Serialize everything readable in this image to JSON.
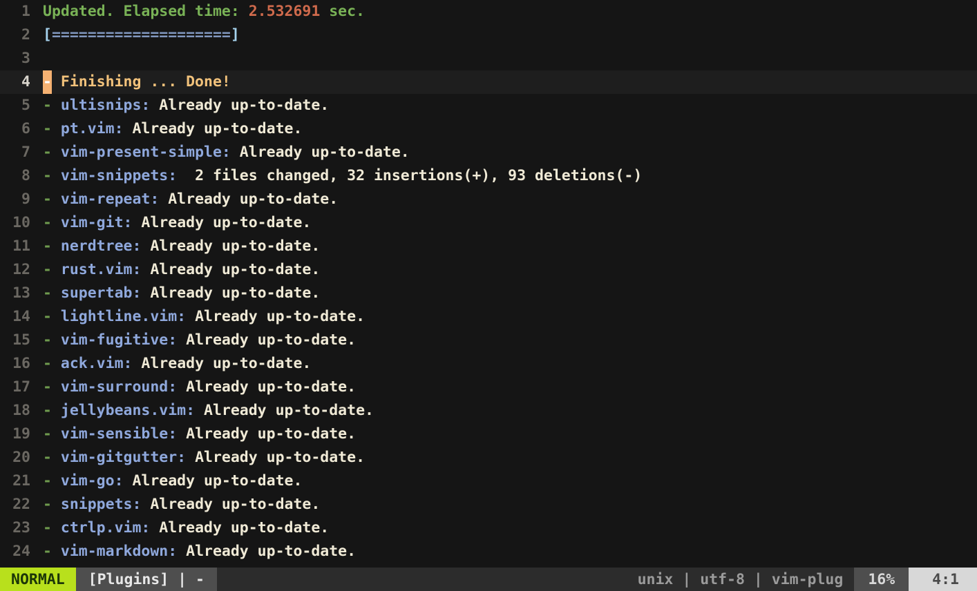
{
  "app": {
    "type": "terminal-vim",
    "buffer_name": "[Plugins]",
    "colors": {
      "background": "#151515",
      "cursorline_bg": "#1e1e1e",
      "linenumber": "#6b6862",
      "linenumber_active": "#d8d4cc",
      "green": "#79b256",
      "red": "#cf6a4c",
      "bracket_blue": "#a6d3ee",
      "equals_blue": "#8197bf",
      "dash_green": "#6f9b4e",
      "plugin_blue": "#8fa8dc",
      "message_cream": "#f0ead6",
      "done_yellow": "#f2c27b",
      "cursor_orange": "#f5b172",
      "status_mode_bg": "#b8e01c",
      "status_mode_fg": "#1c3608",
      "status_file_bg": "#4e4e4e",
      "status_mid_bg": "#2c2c2c",
      "status_pos_bg": "#d8d8d8"
    }
  },
  "buffer": {
    "lines": [
      {
        "number": "1",
        "cursorline": false,
        "segments": [
          {
            "text": "Updated. Elapsed time: ",
            "cls": "c-green"
          },
          {
            "text": "2.532691",
            "cls": "c-red"
          },
          {
            "text": " sec.",
            "cls": "c-green"
          }
        ]
      },
      {
        "number": "2",
        "cursorline": false,
        "segments": [
          {
            "text": "[",
            "cls": "c-bracket"
          },
          {
            "text": "====================",
            "cls": "c-eq"
          },
          {
            "text": "]",
            "cls": "c-bracket"
          }
        ]
      },
      {
        "number": "3",
        "cursorline": false,
        "segments": []
      },
      {
        "number": "4",
        "cursorline": true,
        "segments": [
          {
            "text": "-",
            "cls": "cursor"
          },
          {
            "text": " Finishing ... Done!",
            "cls": "c-done"
          }
        ]
      },
      {
        "number": "5",
        "cursorline": false,
        "segments": [
          {
            "text": "-",
            "cls": "c-dash"
          },
          {
            "text": " ",
            "cls": "c-msg"
          },
          {
            "text": "ultisnips:",
            "cls": "c-plugin"
          },
          {
            "text": " Already up-to-date.",
            "cls": "c-msg"
          }
        ]
      },
      {
        "number": "6",
        "cursorline": false,
        "segments": [
          {
            "text": "-",
            "cls": "c-dash"
          },
          {
            "text": " ",
            "cls": "c-msg"
          },
          {
            "text": "pt.vim:",
            "cls": "c-plugin"
          },
          {
            "text": " Already up-to-date.",
            "cls": "c-msg"
          }
        ]
      },
      {
        "number": "7",
        "cursorline": false,
        "segments": [
          {
            "text": "-",
            "cls": "c-dash"
          },
          {
            "text": " ",
            "cls": "c-msg"
          },
          {
            "text": "vim-present-simple:",
            "cls": "c-plugin"
          },
          {
            "text": " Already up-to-date.",
            "cls": "c-msg"
          }
        ]
      },
      {
        "number": "8",
        "cursorline": false,
        "segments": [
          {
            "text": "-",
            "cls": "c-dash"
          },
          {
            "text": " ",
            "cls": "c-msg"
          },
          {
            "text": "vim-snippets:",
            "cls": "c-plugin"
          },
          {
            "text": "  2 files changed, 32 insertions(+), 93 deletions(-)",
            "cls": "c-msg"
          }
        ]
      },
      {
        "number": "9",
        "cursorline": false,
        "segments": [
          {
            "text": "-",
            "cls": "c-dash"
          },
          {
            "text": " ",
            "cls": "c-msg"
          },
          {
            "text": "vim-repeat:",
            "cls": "c-plugin"
          },
          {
            "text": " Already up-to-date.",
            "cls": "c-msg"
          }
        ]
      },
      {
        "number": "10",
        "cursorline": false,
        "segments": [
          {
            "text": "-",
            "cls": "c-dash"
          },
          {
            "text": " ",
            "cls": "c-msg"
          },
          {
            "text": "vim-git:",
            "cls": "c-plugin"
          },
          {
            "text": " Already up-to-date.",
            "cls": "c-msg"
          }
        ]
      },
      {
        "number": "11",
        "cursorline": false,
        "segments": [
          {
            "text": "-",
            "cls": "c-dash"
          },
          {
            "text": " ",
            "cls": "c-msg"
          },
          {
            "text": "nerdtree:",
            "cls": "c-plugin"
          },
          {
            "text": " Already up-to-date.",
            "cls": "c-msg"
          }
        ]
      },
      {
        "number": "12",
        "cursorline": false,
        "segments": [
          {
            "text": "-",
            "cls": "c-dash"
          },
          {
            "text": " ",
            "cls": "c-msg"
          },
          {
            "text": "rust.vim:",
            "cls": "c-plugin"
          },
          {
            "text": " Already up-to-date.",
            "cls": "c-msg"
          }
        ]
      },
      {
        "number": "13",
        "cursorline": false,
        "segments": [
          {
            "text": "-",
            "cls": "c-dash"
          },
          {
            "text": " ",
            "cls": "c-msg"
          },
          {
            "text": "supertab:",
            "cls": "c-plugin"
          },
          {
            "text": " Already up-to-date.",
            "cls": "c-msg"
          }
        ]
      },
      {
        "number": "14",
        "cursorline": false,
        "segments": [
          {
            "text": "-",
            "cls": "c-dash"
          },
          {
            "text": " ",
            "cls": "c-msg"
          },
          {
            "text": "lightline.vim:",
            "cls": "c-plugin"
          },
          {
            "text": " Already up-to-date.",
            "cls": "c-msg"
          }
        ]
      },
      {
        "number": "15",
        "cursorline": false,
        "segments": [
          {
            "text": "-",
            "cls": "c-dash"
          },
          {
            "text": " ",
            "cls": "c-msg"
          },
          {
            "text": "vim-fugitive:",
            "cls": "c-plugin"
          },
          {
            "text": " Already up-to-date.",
            "cls": "c-msg"
          }
        ]
      },
      {
        "number": "16",
        "cursorline": false,
        "segments": [
          {
            "text": "-",
            "cls": "c-dash"
          },
          {
            "text": " ",
            "cls": "c-msg"
          },
          {
            "text": "ack.vim:",
            "cls": "c-plugin"
          },
          {
            "text": " Already up-to-date.",
            "cls": "c-msg"
          }
        ]
      },
      {
        "number": "17",
        "cursorline": false,
        "segments": [
          {
            "text": "-",
            "cls": "c-dash"
          },
          {
            "text": " ",
            "cls": "c-msg"
          },
          {
            "text": "vim-surround:",
            "cls": "c-plugin"
          },
          {
            "text": " Already up-to-date.",
            "cls": "c-msg"
          }
        ]
      },
      {
        "number": "18",
        "cursorline": false,
        "segments": [
          {
            "text": "-",
            "cls": "c-dash"
          },
          {
            "text": " ",
            "cls": "c-msg"
          },
          {
            "text": "jellybeans.vim:",
            "cls": "c-plugin"
          },
          {
            "text": " Already up-to-date.",
            "cls": "c-msg"
          }
        ]
      },
      {
        "number": "19",
        "cursorline": false,
        "segments": [
          {
            "text": "-",
            "cls": "c-dash"
          },
          {
            "text": " ",
            "cls": "c-msg"
          },
          {
            "text": "vim-sensible:",
            "cls": "c-plugin"
          },
          {
            "text": " Already up-to-date.",
            "cls": "c-msg"
          }
        ]
      },
      {
        "number": "20",
        "cursorline": false,
        "segments": [
          {
            "text": "-",
            "cls": "c-dash"
          },
          {
            "text": " ",
            "cls": "c-msg"
          },
          {
            "text": "vim-gitgutter:",
            "cls": "c-plugin"
          },
          {
            "text": " Already up-to-date.",
            "cls": "c-msg"
          }
        ]
      },
      {
        "number": "21",
        "cursorline": false,
        "segments": [
          {
            "text": "-",
            "cls": "c-dash"
          },
          {
            "text": " ",
            "cls": "c-msg"
          },
          {
            "text": "vim-go:",
            "cls": "c-plugin"
          },
          {
            "text": " Already up-to-date.",
            "cls": "c-msg"
          }
        ]
      },
      {
        "number": "22",
        "cursorline": false,
        "segments": [
          {
            "text": "-",
            "cls": "c-dash"
          },
          {
            "text": " ",
            "cls": "c-msg"
          },
          {
            "text": "snippets:",
            "cls": "c-plugin"
          },
          {
            "text": " Already up-to-date.",
            "cls": "c-msg"
          }
        ]
      },
      {
        "number": "23",
        "cursorline": false,
        "segments": [
          {
            "text": "-",
            "cls": "c-dash"
          },
          {
            "text": " ",
            "cls": "c-msg"
          },
          {
            "text": "ctrlp.vim:",
            "cls": "c-plugin"
          },
          {
            "text": " Already up-to-date.",
            "cls": "c-msg"
          }
        ]
      },
      {
        "number": "24",
        "cursorline": false,
        "segments": [
          {
            "text": "-",
            "cls": "c-dash"
          },
          {
            "text": " ",
            "cls": "c-msg"
          },
          {
            "text": "vim-markdown:",
            "cls": "c-plugin"
          },
          {
            "text": " Already up-to-date.",
            "cls": "c-msg"
          }
        ]
      }
    ]
  },
  "statusline": {
    "mode": "NORMAL",
    "filename": "[Plugins] | -",
    "fileformat": "unix",
    "encoding": "utf-8",
    "filetype": "vim-plug",
    "separator": "|",
    "info": "unix | utf-8 | vim-plug",
    "percent": "16%",
    "position": "4:1"
  }
}
